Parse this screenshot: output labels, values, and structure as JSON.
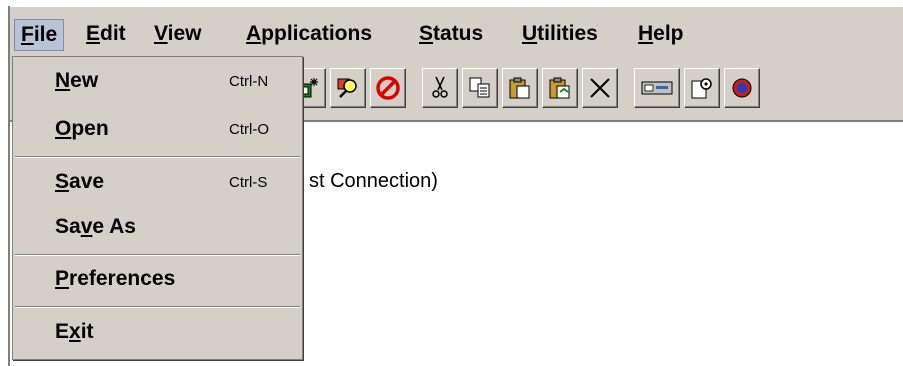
{
  "menubar": {
    "items": [
      {
        "label": "File",
        "mnemonic": "F",
        "rest": "ile"
      },
      {
        "label": "Edit",
        "mnemonic": "E",
        "rest": "dit"
      },
      {
        "label": "View",
        "mnemonic": "V",
        "rest": "iew"
      },
      {
        "label": "Applications",
        "mnemonic": "A",
        "rest": "pplications"
      },
      {
        "label": "Status",
        "mnemonic": "S",
        "rest": "tatus"
      },
      {
        "label": "Utilities",
        "mnemonic": "U",
        "rest": "tilities"
      },
      {
        "label": "Help",
        "mnemonic": "H",
        "rest": "elp"
      }
    ]
  },
  "file_menu": {
    "items": [
      {
        "pre": "",
        "mnemonic": "N",
        "rest": "ew",
        "accel": "Ctrl-N"
      },
      {
        "pre": "",
        "mnemonic": "O",
        "rest": "pen",
        "accel": "Ctrl-O"
      },
      {
        "pre": "",
        "mnemonic": "S",
        "rest": "ave",
        "accel": "Ctrl-S"
      },
      {
        "pre": "Sa",
        "mnemonic": "v",
        "rest": "e As",
        "accel": ""
      },
      {
        "pre": "",
        "mnemonic": "P",
        "rest": "references",
        "accel": ""
      },
      {
        "pre": "E",
        "mnemonic": "x",
        "rest": "it",
        "accel": ""
      }
    ]
  },
  "toolbar": {
    "buttons": [
      {
        "icon": "new-connection-icon"
      },
      {
        "icon": "find-icon"
      },
      {
        "icon": "stop-icon"
      },
      {
        "icon": "cut-icon"
      },
      {
        "icon": "copy-icon"
      },
      {
        "icon": "paste-icon"
      },
      {
        "icon": "paste-special-icon"
      },
      {
        "icon": "delete-icon"
      },
      {
        "icon": "device-icon"
      },
      {
        "icon": "properties-icon"
      },
      {
        "icon": "help-icon"
      }
    ]
  },
  "content": {
    "text": "st Connection)"
  }
}
